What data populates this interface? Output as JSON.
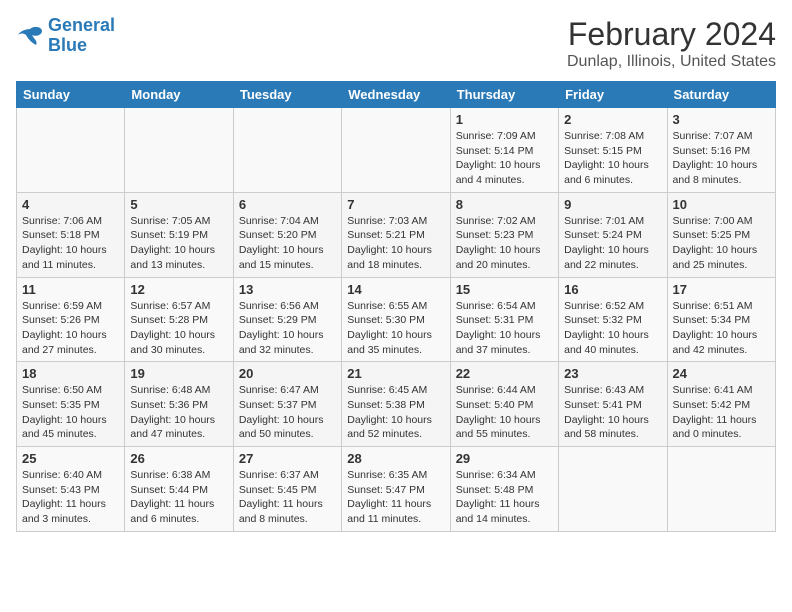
{
  "header": {
    "logo_line1": "General",
    "logo_line2": "Blue",
    "title": "February 2024",
    "subtitle": "Dunlap, Illinois, United States"
  },
  "weekdays": [
    "Sunday",
    "Monday",
    "Tuesday",
    "Wednesday",
    "Thursday",
    "Friday",
    "Saturday"
  ],
  "weeks": [
    [
      {
        "day": "",
        "info": ""
      },
      {
        "day": "",
        "info": ""
      },
      {
        "day": "",
        "info": ""
      },
      {
        "day": "",
        "info": ""
      },
      {
        "day": "1",
        "info": "Sunrise: 7:09 AM\nSunset: 5:14 PM\nDaylight: 10 hours\nand 4 minutes."
      },
      {
        "day": "2",
        "info": "Sunrise: 7:08 AM\nSunset: 5:15 PM\nDaylight: 10 hours\nand 6 minutes."
      },
      {
        "day": "3",
        "info": "Sunrise: 7:07 AM\nSunset: 5:16 PM\nDaylight: 10 hours\nand 8 minutes."
      }
    ],
    [
      {
        "day": "4",
        "info": "Sunrise: 7:06 AM\nSunset: 5:18 PM\nDaylight: 10 hours\nand 11 minutes."
      },
      {
        "day": "5",
        "info": "Sunrise: 7:05 AM\nSunset: 5:19 PM\nDaylight: 10 hours\nand 13 minutes."
      },
      {
        "day": "6",
        "info": "Sunrise: 7:04 AM\nSunset: 5:20 PM\nDaylight: 10 hours\nand 15 minutes."
      },
      {
        "day": "7",
        "info": "Sunrise: 7:03 AM\nSunset: 5:21 PM\nDaylight: 10 hours\nand 18 minutes."
      },
      {
        "day": "8",
        "info": "Sunrise: 7:02 AM\nSunset: 5:23 PM\nDaylight: 10 hours\nand 20 minutes."
      },
      {
        "day": "9",
        "info": "Sunrise: 7:01 AM\nSunset: 5:24 PM\nDaylight: 10 hours\nand 22 minutes."
      },
      {
        "day": "10",
        "info": "Sunrise: 7:00 AM\nSunset: 5:25 PM\nDaylight: 10 hours\nand 25 minutes."
      }
    ],
    [
      {
        "day": "11",
        "info": "Sunrise: 6:59 AM\nSunset: 5:26 PM\nDaylight: 10 hours\nand 27 minutes."
      },
      {
        "day": "12",
        "info": "Sunrise: 6:57 AM\nSunset: 5:28 PM\nDaylight: 10 hours\nand 30 minutes."
      },
      {
        "day": "13",
        "info": "Sunrise: 6:56 AM\nSunset: 5:29 PM\nDaylight: 10 hours\nand 32 minutes."
      },
      {
        "day": "14",
        "info": "Sunrise: 6:55 AM\nSunset: 5:30 PM\nDaylight: 10 hours\nand 35 minutes."
      },
      {
        "day": "15",
        "info": "Sunrise: 6:54 AM\nSunset: 5:31 PM\nDaylight: 10 hours\nand 37 minutes."
      },
      {
        "day": "16",
        "info": "Sunrise: 6:52 AM\nSunset: 5:32 PM\nDaylight: 10 hours\nand 40 minutes."
      },
      {
        "day": "17",
        "info": "Sunrise: 6:51 AM\nSunset: 5:34 PM\nDaylight: 10 hours\nand 42 minutes."
      }
    ],
    [
      {
        "day": "18",
        "info": "Sunrise: 6:50 AM\nSunset: 5:35 PM\nDaylight: 10 hours\nand 45 minutes."
      },
      {
        "day": "19",
        "info": "Sunrise: 6:48 AM\nSunset: 5:36 PM\nDaylight: 10 hours\nand 47 minutes."
      },
      {
        "day": "20",
        "info": "Sunrise: 6:47 AM\nSunset: 5:37 PM\nDaylight: 10 hours\nand 50 minutes."
      },
      {
        "day": "21",
        "info": "Sunrise: 6:45 AM\nSunset: 5:38 PM\nDaylight: 10 hours\nand 52 minutes."
      },
      {
        "day": "22",
        "info": "Sunrise: 6:44 AM\nSunset: 5:40 PM\nDaylight: 10 hours\nand 55 minutes."
      },
      {
        "day": "23",
        "info": "Sunrise: 6:43 AM\nSunset: 5:41 PM\nDaylight: 10 hours\nand 58 minutes."
      },
      {
        "day": "24",
        "info": "Sunrise: 6:41 AM\nSunset: 5:42 PM\nDaylight: 11 hours\nand 0 minutes."
      }
    ],
    [
      {
        "day": "25",
        "info": "Sunrise: 6:40 AM\nSunset: 5:43 PM\nDaylight: 11 hours\nand 3 minutes."
      },
      {
        "day": "26",
        "info": "Sunrise: 6:38 AM\nSunset: 5:44 PM\nDaylight: 11 hours\nand 6 minutes."
      },
      {
        "day": "27",
        "info": "Sunrise: 6:37 AM\nSunset: 5:45 PM\nDaylight: 11 hours\nand 8 minutes."
      },
      {
        "day": "28",
        "info": "Sunrise: 6:35 AM\nSunset: 5:47 PM\nDaylight: 11 hours\nand 11 minutes."
      },
      {
        "day": "29",
        "info": "Sunrise: 6:34 AM\nSunset: 5:48 PM\nDaylight: 11 hours\nand 14 minutes."
      },
      {
        "day": "",
        "info": ""
      },
      {
        "day": "",
        "info": ""
      }
    ]
  ]
}
